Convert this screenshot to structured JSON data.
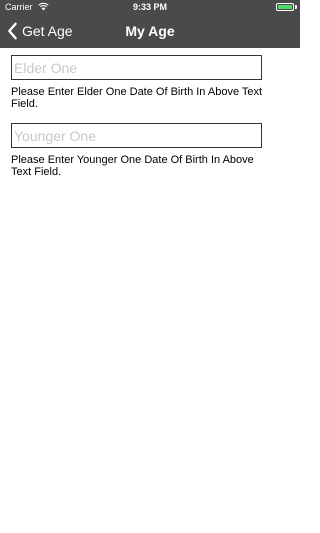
{
  "status_bar": {
    "carrier": "Carrier",
    "time": "9:33 PM",
    "wifi_icon": "wifi-icon",
    "battery_icon": "battery-icon",
    "battery_color": "#4cd964"
  },
  "nav_bar": {
    "back_label": "Get Age",
    "back_icon": "chevron-left-icon",
    "title": "My Age",
    "background": "#4a4a4a"
  },
  "form": {
    "elder": {
      "placeholder": "Elder One",
      "value": "",
      "hint": "Please Enter Elder One Date Of Birth In Above Text Field."
    },
    "younger": {
      "placeholder": "Younger One",
      "value": "",
      "hint": "Please Enter Younger One Date Of Birth In Above Text Field."
    }
  }
}
